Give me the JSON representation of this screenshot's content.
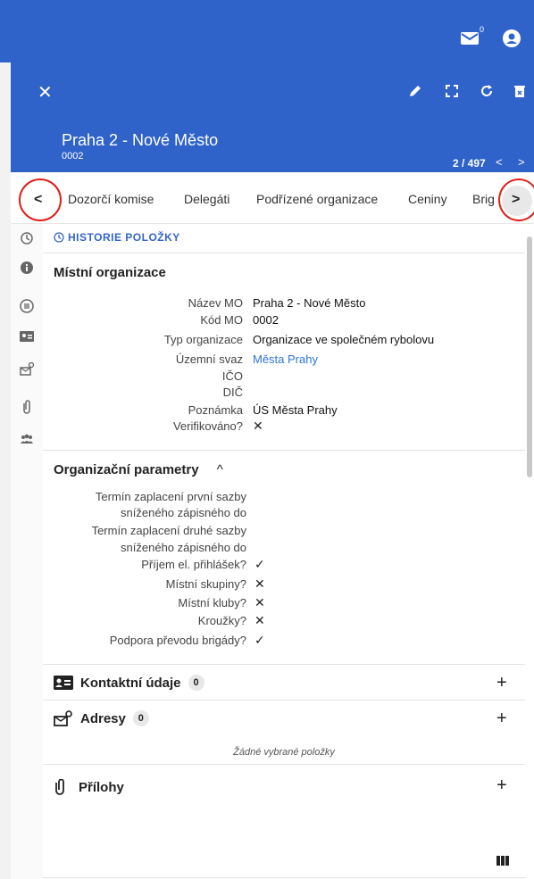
{
  "topbar": {
    "mail_count": "0",
    "mail_icon": "mail-icon",
    "user_icon": "account-icon"
  },
  "header": {
    "close": "✕",
    "title": "Praha 2 - Nové Město",
    "code": "0002",
    "pager": "2 / 497",
    "prev": "<",
    "next": ">"
  },
  "tabs": {
    "prev_arrow": "<",
    "next_arrow": ">",
    "items": [
      "Dozorčí komise",
      "Delegáti",
      "Podřízené organizace",
      "Ceniny",
      "Brig"
    ]
  },
  "history": {
    "label": "HISTORIE POLOŽKY"
  },
  "mo": {
    "title": "Místní organizace",
    "rows": [
      {
        "label": "Název MO",
        "value": "Praha 2 - Nové Město"
      },
      {
        "label": "Kód MO",
        "value": "0002"
      },
      {
        "label": "Typ organizace",
        "value": "Organizace ve společném rybolovu"
      },
      {
        "label": "Územní svaz",
        "value": "Města Prahy"
      },
      {
        "label": "IČO",
        "value": ""
      },
      {
        "label": "DIČ",
        "value": ""
      },
      {
        "label": "Poznámka",
        "value": "ÚS Města Prahy"
      },
      {
        "label": "Verifikováno?",
        "value": "✕"
      }
    ]
  },
  "params": {
    "title": "Organizační parametry",
    "toggle": "^",
    "rows": [
      {
        "label": "Termín zaplacení první sazby",
        "value": ""
      },
      {
        "label": "sníženého zápisného do",
        "value": ""
      },
      {
        "label": "Termín zaplacení druhé sazby",
        "value": ""
      },
      {
        "label": "sníženého zápisného do",
        "value": ""
      },
      {
        "label": "Příjem el. přihlášek?",
        "value": "✓"
      },
      {
        "label": "Místní skupiny?",
        "value": "✕"
      },
      {
        "label": "Místní kluby?",
        "value": "✕"
      },
      {
        "label": "Kroužky?",
        "value": "✕"
      },
      {
        "label": "Podpora převodu brigády?",
        "value": "✓"
      }
    ]
  },
  "contacts": {
    "title": "Kontaktní údaje",
    "count": "0",
    "add": "+"
  },
  "addresses": {
    "title": "Adresy",
    "count": "0",
    "add": "+",
    "empty": "Žádné vybrané položky"
  },
  "attachments": {
    "title": "Přílohy",
    "add": "+"
  }
}
